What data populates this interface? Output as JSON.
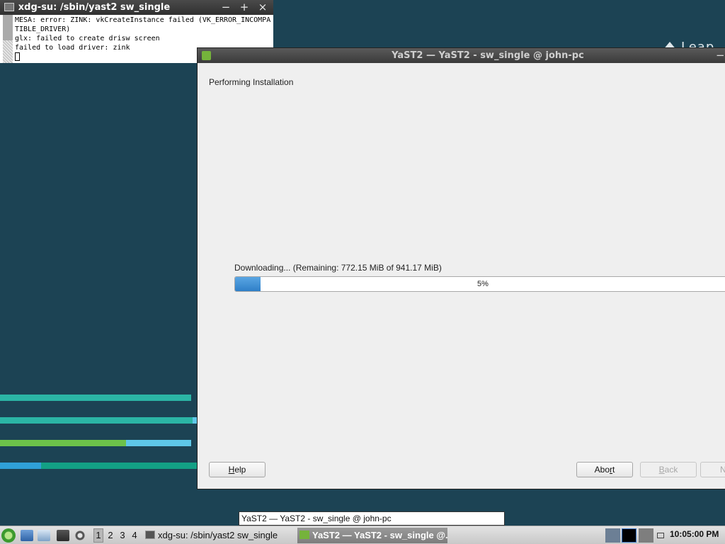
{
  "desktop": {
    "brand_text": "Leap",
    "stripes": [
      {
        "left_color": "#2bb5a5",
        "right_color": "#2bb5a5",
        "accent_fraction": 1.0
      },
      {
        "left_color": "#2bb5a5",
        "right_color": "#5ec7e8",
        "accent_fraction": 0.98
      },
      {
        "left_color": "#6cc24a",
        "right_color": "#5ec7e8",
        "accent_fraction": 0.66
      },
      {
        "left_color": "#2fa0d8",
        "right_color": "#13a085",
        "accent_fraction": 0.21
      }
    ]
  },
  "terminal": {
    "title": "xdg-su: /sbin/yast2 sw_single",
    "controls": {
      "minimize": "−",
      "maximize": "+",
      "close": "×"
    },
    "lines": [
      "MESA: error: ZINK: vkCreateInstance failed (VK_ERROR_INCOMPA",
      "TIBLE_DRIVER)",
      "glx: failed to create drisw screen",
      "failed to load driver: zink"
    ]
  },
  "yast": {
    "title": "YaST2 — YaST2 - sw_single @ john-pc",
    "title_control": "−",
    "heading": "Performing Installation",
    "download_label": "Downloading... (Remaining: 772.15 MiB of 941.17 MiB)",
    "progress_percent": 5,
    "progress_text": "5%",
    "buttons": {
      "help_prefix": "",
      "help_underlined": "H",
      "help_rest": "elp",
      "abort_prefix": "Abo",
      "abort_underlined": "r",
      "abort_rest": "t",
      "back_underlined": "B",
      "back_rest": "ack",
      "next_partial": "N"
    }
  },
  "tooltip": {
    "text": "YaST2 — YaST2 - sw_single @ john-pc"
  },
  "taskbar": {
    "desktops": [
      "1",
      "2",
      "3",
      "4"
    ],
    "active_desktop": "1",
    "tasks": [
      {
        "label": "xdg-su: /sbin/yast2 sw_single",
        "icon": "terminal-icon",
        "active": false
      },
      {
        "label": "YaST2 — YaST2 - sw_single @...",
        "icon": "yast-icon",
        "active": true
      }
    ],
    "clock": "10:05:00 PM",
    "colors": {
      "accent": "#75b33b",
      "progress": "#3b8ad3"
    }
  }
}
